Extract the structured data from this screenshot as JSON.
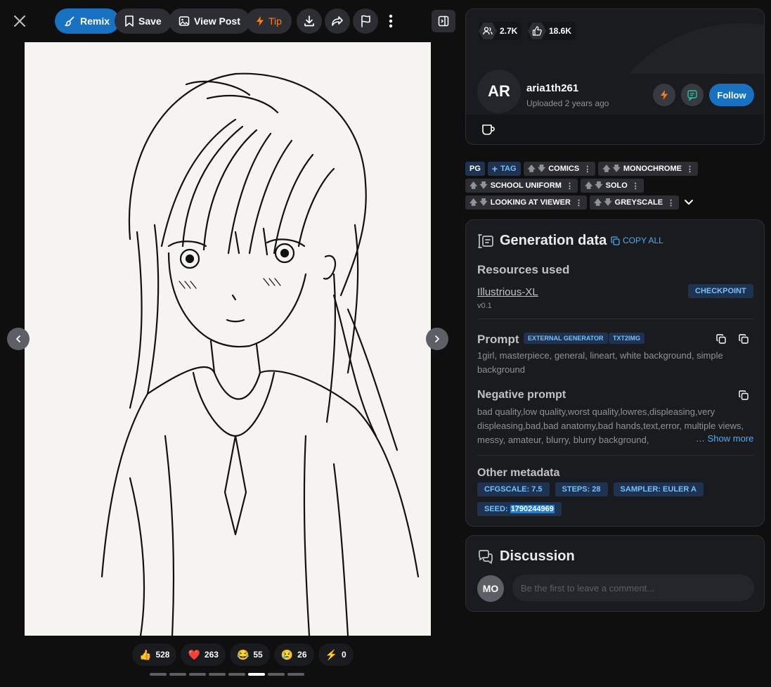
{
  "toolbar": {
    "remix_label": "Remix",
    "save_label": "Save",
    "view_post_label": "View Post",
    "tip_label": "Tip"
  },
  "reactions": [
    {
      "emoji": "👍",
      "count": "528"
    },
    {
      "emoji": "❤️",
      "count": "263"
    },
    {
      "emoji": "😂",
      "count": "55"
    },
    {
      "emoji": "😢",
      "count": "26"
    },
    {
      "emoji": "⚡",
      "count": "0"
    }
  ],
  "carousel": {
    "total": 8,
    "active_index": 5
  },
  "creator": {
    "followers": "2.7K",
    "likes": "18.6K",
    "avatar_initials": "AR",
    "username": "aria1th261",
    "uploaded": "Uploaded 2 years ago",
    "follow_label": "Follow"
  },
  "tags": {
    "rating": "PG",
    "add_tag": "TAG",
    "items": [
      "COMICS",
      "MONOCHROME",
      "SCHOOL UNIFORM",
      "SOLO",
      "LOOKING AT VIEWER",
      "GREYSCALE"
    ]
  },
  "generation": {
    "title": "Generation data",
    "copy_all": "COPY ALL",
    "resources_title": "Resources used",
    "resource_name": "Illustrious-XL",
    "resource_version": "v0.1",
    "resource_type": "CHECKPOINT",
    "prompt_title": "Prompt",
    "prompt_badges": [
      "EXTERNAL GENERATOR",
      "TXT2IMG"
    ],
    "prompt_text": "1girl, masterpiece, general, lineart, white background, simple background",
    "negative_title": "Negative prompt",
    "negative_text": "bad quality,low quality,worst quality,lowres,displeasing,very displeasing,bad,bad anatomy,bad hands,text,error, multiple views, messy, amateur, blurry, blurry background,",
    "show_more": "… Show more",
    "other_title": "Other metadata",
    "meta": {
      "cfg": "CFGSCALE: 7.5",
      "steps": "STEPS: 28",
      "sampler": "SAMPLER: EULER A",
      "seed_label": "SEED:",
      "seed_value": "1790244969"
    }
  },
  "discussion": {
    "title": "Discussion",
    "avatar_initials": "MO",
    "placeholder": "Be the first to leave a comment..."
  },
  "colors": {
    "accent": "#1971c2",
    "tip": "#fd7e14",
    "link": "#4dabf7",
    "background": "#0f0f10",
    "card": "#1a1b1e"
  }
}
